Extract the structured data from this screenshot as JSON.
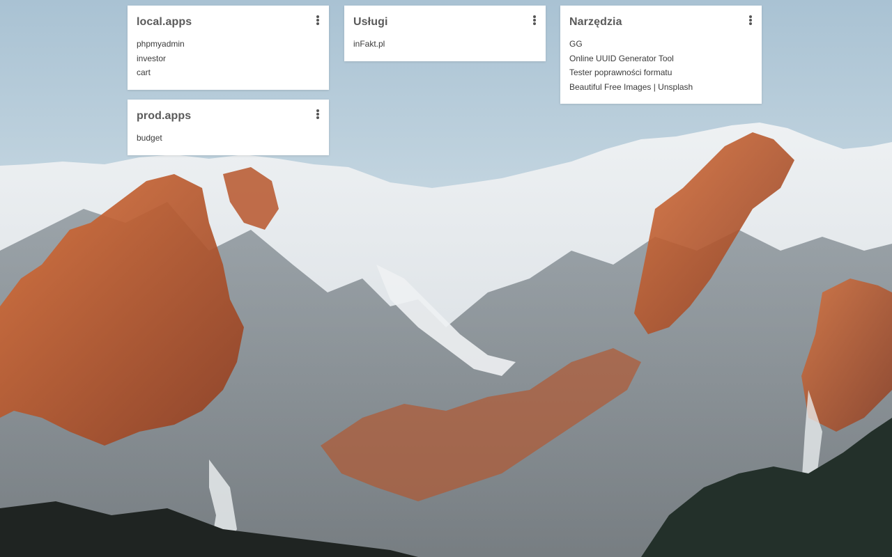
{
  "background": {
    "sky_color": "#b9cfdc",
    "rock_color": "#c2602f",
    "snow_color": "#e8ecef",
    "forest_color": "#1f2422"
  },
  "widgets": [
    {
      "title": "local.apps",
      "menu_icon": "more-vertical-icon",
      "links": [
        "phpmyadmin",
        "investor",
        "cart"
      ]
    },
    {
      "title": "prod.apps",
      "menu_icon": "more-vertical-icon",
      "links": [
        "budget"
      ]
    },
    {
      "title": "Usługi",
      "menu_icon": "more-vertical-icon",
      "links": [
        "inFakt.pl"
      ]
    },
    {
      "title": "Narzędzia",
      "menu_icon": "more-vertical-icon",
      "links": [
        "GG",
        "Online UUID Generator Tool",
        "Tester poprawności formatu",
        "Beautiful Free Images | Unsplash"
      ]
    }
  ]
}
